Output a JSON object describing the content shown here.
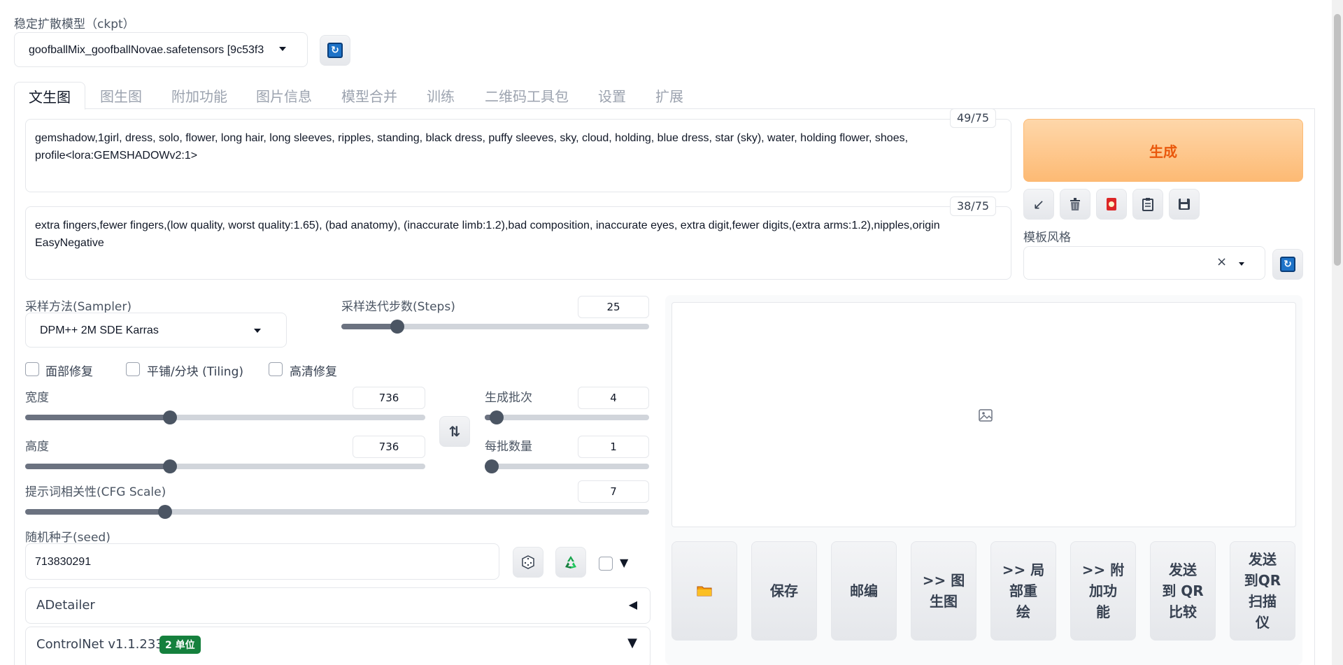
{
  "checkpoint": {
    "label": "稳定扩散模型（ckpt）",
    "value": "goofballMix_goofballNovae.safetensors [9c53f3"
  },
  "tabs": [
    "文生图",
    "图生图",
    "附加功能",
    "图片信息",
    "模型合并",
    "训练",
    "二维码工具包",
    "设置",
    "扩展"
  ],
  "prompt": {
    "counter": "49/75",
    "line1": "gemshadow,1girl, dress, solo, flower, long hair, long sleeves, ripples, standing, black dress, puffy sleeves, sky, cloud, holding, blue dress, star (sky), water, holding flower, shoes,",
    "line2": "profile<lora:GEMSHADOWv2:1>"
  },
  "negative_prompt": {
    "counter": "38/75",
    "line1": "extra fingers,fewer fingers,(low quality, worst quality:1.65), (bad anatomy), (inaccurate limb:1.2),bad composition, inaccurate eyes, extra digit,fewer digits,(extra arms:1.2),nipples,origin",
    "line2": "EasyNegative"
  },
  "generate": {
    "label": "生成",
    "color": "#ea580c"
  },
  "style": {
    "label": "模板风格",
    "clear_icon": "×"
  },
  "sampler": {
    "label": "采样方法(Sampler)",
    "value": "DPM++ 2M SDE Karras"
  },
  "steps": {
    "label": "采样迭代步数(Steps)",
    "value": "25",
    "fraction": 0.16
  },
  "checkboxes": {
    "face_restore": "面部修复",
    "tiling": "平铺/分块 (Tiling)",
    "hires": "高清修复"
  },
  "width": {
    "label": "宽度",
    "value": "736",
    "fraction": 0.345
  },
  "height": {
    "label": "高度",
    "value": "736",
    "fraction": 0.345
  },
  "batch_count": {
    "label": "生成批次",
    "value": "4",
    "fraction": 0.03
  },
  "batch_size": {
    "label": "每批数量",
    "value": "1",
    "fraction": 0.0
  },
  "cfg": {
    "label": "提示词相关性(CFG Scale)",
    "value": "7",
    "fraction": 0.213
  },
  "seed": {
    "label": "随机种子(seed)",
    "value": "713830291",
    "extra_arrow": "▼"
  },
  "adetailer": {
    "label": "ADetailer",
    "arrow": "◀"
  },
  "controlnet": {
    "label": "ControlNet v1.1.233",
    "badge": "2 单位",
    "badge_color": "#15803d",
    "arrow": "▼"
  },
  "output_buttons": [
    "",
    "保存",
    "邮编",
    ">> 图\n生图",
    ">> 局\n部重\n绘",
    ">> 附\n加功\n能",
    "发送\n到 QR\n比较",
    "发送\n到QR\n扫描\n仪"
  ],
  "icons": {
    "refresh": "refresh-icon",
    "swap": "⇅",
    "dice": "dice-icon",
    "recycle": "recycle-icon",
    "folder": "folder-icon"
  }
}
